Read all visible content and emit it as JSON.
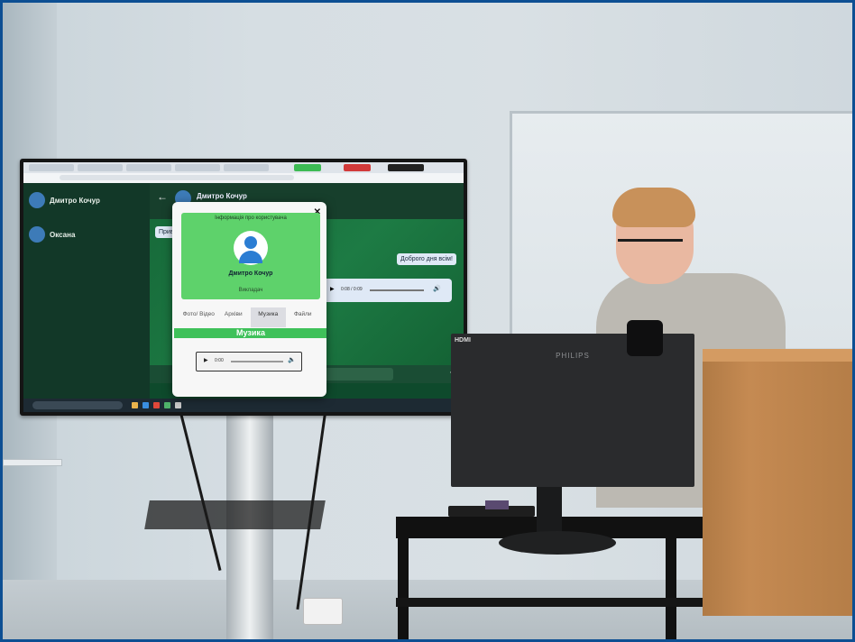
{
  "tv": {
    "contacts": [
      {
        "name": "Дмитро Кочур"
      },
      {
        "name": "Оксана"
      }
    ],
    "chat": {
      "contact_name": "Дмитро Кочур",
      "back_icon": "arrow-left-icon",
      "messages": [
        {
          "text": "Прив",
          "side": "left"
        },
        {
          "text": "Доброго дня всім!",
          "side": "right"
        }
      ],
      "audio_time": "0:08 / 0:09"
    },
    "modal": {
      "title": "Інформація про користувача",
      "close_icon": "close-icon",
      "user_name": "Дмитро Кочур",
      "user_role": "Викладач",
      "tabs": [
        {
          "label": "Фото/ Відео",
          "active": false
        },
        {
          "label": "Архіви",
          "active": false
        },
        {
          "label": "Музика",
          "active": true
        },
        {
          "label": "Файли",
          "active": false
        }
      ],
      "section_title": "Музика",
      "player": {
        "time": "0:00",
        "play_icon": "play-icon",
        "volume_icon": "volume-icon"
      }
    }
  },
  "monitor": {
    "brand": "PHILIPS",
    "tag": "HDMI"
  },
  "colors": {
    "accent_green": "#5ed26b",
    "section_green": "#3fc15a",
    "avatar_blue": "#2b7dd3"
  }
}
